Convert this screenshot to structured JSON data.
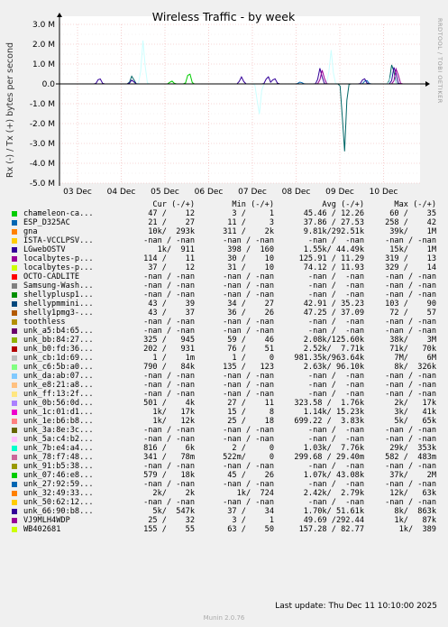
{
  "chart_data": {
    "type": "line",
    "title": "Wireless Traffic - by week",
    "ylabel": "Rx (-) / Tx (+) bytes per second",
    "ylim": [
      -5000000,
      3000000
    ],
    "y_ticks": [
      3000000,
      2000000,
      1000000,
      0,
      -1000000,
      -2000000,
      -3000000,
      -4000000,
      -5000000
    ],
    "y_tick_labels": [
      "3.0 M",
      "2.0 M",
      "1.0 M",
      "0.0",
      "-1.0 M",
      "-2.0 M",
      "-3.0 M",
      "-4.0 M",
      "-5.0 M"
    ],
    "x_tick_labels": [
      "03 Dec",
      "04 Dec",
      "05 Dec",
      "06 Dec",
      "07 Dec",
      "08 Dec",
      "09 Dec",
      "10 Dec"
    ],
    "grid": true,
    "series": [
      {
        "name": "chameleon-ca...",
        "color": "#00cc00",
        "peaks": [
          [
            2.55,
            600000
          ],
          [
            2.15,
            150000
          ]
        ]
      },
      {
        "name": "ESP_D325AC",
        "color": "#0066b3",
        "peaks": [
          [
            6.6,
            200000
          ],
          [
            5.1,
            100000
          ]
        ]
      },
      {
        "name": "shellypmmini...",
        "color": "#006666",
        "peaks": [
          [
            1.25,
            400000
          ],
          [
            6.1,
            1300000
          ],
          [
            6.1,
            -4800000
          ],
          [
            7.2,
            1050000
          ]
        ]
      },
      {
        "name": "unk_7b:e4:a4...",
        "color": "#ccffff",
        "peaks": [
          [
            1.5,
            2200000
          ],
          [
            4.15,
            2400000
          ],
          [
            4.15,
            -4000000
          ],
          [
            5.8,
            1700000
          ],
          [
            7.2,
            1400000
          ],
          [
            7.2,
            -800000
          ]
        ]
      },
      {
        "name": "unk_a5:b4:65...",
        "color": "#330099",
        "peaks": [
          [
            0.5,
            300000
          ],
          [
            3.75,
            350000
          ],
          [
            4.35,
            400000
          ],
          [
            5.55,
            800000
          ],
          [
            7.25,
            900000
          ],
          [
            4.5,
            300000
          ],
          [
            6.55,
            300000
          ],
          [
            1.25,
            200000
          ]
        ]
      },
      {
        "name": "unk_bb:84:27...",
        "color": "#990099",
        "peaks": [
          [
            5.6,
            700000
          ],
          [
            7.3,
            800000
          ]
        ]
      }
    ]
  },
  "side_text": "RRDTOOL / TOBI OETIKER",
  "legend": {
    "headers": {
      "cur": "Cur (-/+)",
      "min": "Min (-/+)",
      "avg": "Avg (-/+)",
      "max": "Max (-/+)"
    },
    "rows": [
      {
        "name": "chameleon-ca...",
        "color": "#00cc00",
        "cur": "47 /    12",
        "min": "3 /     1",
        "avg": "45.46 / 12.26",
        "max": "60 /    35"
      },
      {
        "name": "ESP_D325AC",
        "color": "#0066b3",
        "cur": "21 /    27",
        "min": "11 /     3",
        "avg": "37.86 / 27.53",
        "max": "258 /    42"
      },
      {
        "name": "gna",
        "color": "#ff8000",
        "cur": "10k/  293k",
        "min": "311 /    2k",
        "avg": "9.81k/292.51k",
        "max": "39k/    1M"
      },
      {
        "name": "ISTA-VCCLPSV...",
        "color": "#ffcc00",
        "cur": "-nan / -nan",
        "min": "-nan / -nan",
        "avg": "-nan /  -nan",
        "max": "-nan / -nan"
      },
      {
        "name": "LGwebOSTV",
        "color": "#330099",
        "cur": "1k/  911",
        "min": "398 /  160",
        "avg": "1.55k/ 44.49k",
        "max": "15k/    1M"
      },
      {
        "name": "localbytes-p...",
        "color": "#990099",
        "cur": "114 /    11",
        "min": "30 /    10",
        "avg": "125.91 / 11.29",
        "max": "319 /    13"
      },
      {
        "name": "localbytes-p...",
        "color": "#ccff00",
        "cur": "37 /    12",
        "min": "31 /    10",
        "avg": "74.12 / 11.93",
        "max": "329 /    14"
      },
      {
        "name": "OCTO-CADLITE",
        "color": "#ff0000",
        "cur": "-nan / -nan",
        "min": "-nan / -nan",
        "avg": "-nan /  -nan",
        "max": "-nan / -nan"
      },
      {
        "name": "Samsung-Wash...",
        "color": "#808080",
        "cur": "-nan / -nan",
        "min": "-nan / -nan",
        "avg": "-nan /  -nan",
        "max": "-nan / -nan"
      },
      {
        "name": "shellyplusp1...",
        "color": "#008f00",
        "cur": "-nan / -nan",
        "min": "-nan / -nan",
        "avg": "-nan /  -nan",
        "max": "-nan / -nan"
      },
      {
        "name": "shellypmmini...",
        "color": "#00487d",
        "cur": "43 /    39",
        "min": "34 /    27",
        "avg": "42.91 / 35.23",
        "max": "103 /    90"
      },
      {
        "name": "shelly1pmg3-...",
        "color": "#b35a00",
        "cur": "43 /    37",
        "min": "36 /    26",
        "avg": "47.25 / 37.09",
        "max": "72 /    57"
      },
      {
        "name": "toothless",
        "color": "#b38f00",
        "cur": "-nan / -nan",
        "min": "-nan / -nan",
        "avg": "-nan /  -nan",
        "max": "-nan / -nan"
      },
      {
        "name": "unk_a5:b4:65...",
        "color": "#6b006b",
        "cur": "-nan / -nan",
        "min": "-nan / -nan",
        "avg": "-nan /  -nan",
        "max": "-nan / -nan"
      },
      {
        "name": "unk_bb:84:27...",
        "color": "#8fb300",
        "cur": "325 /   945",
        "min": "59 /    46",
        "avg": "2.08k/125.60k",
        "max": "38k/    3M"
      },
      {
        "name": "unk_b0:fd:36...",
        "color": "#b30000",
        "cur": "202 /   931",
        "min": "76 /    51",
        "avg": "2.52k/  7.71k",
        "max": "71k/   70k"
      },
      {
        "name": "unk_cb:1d:69...",
        "color": "#bebebe",
        "cur": "1 /    1m",
        "min": "1 /     0",
        "avg": "981.35k/963.64k",
        "max": "7M/    6M"
      },
      {
        "name": "unk_c6:5b:a0...",
        "color": "#80ff80",
        "cur": "790 /   84k",
        "min": "135 /   123",
        "avg": "2.63k/ 96.10k",
        "max": "8k/  326k"
      },
      {
        "name": "unk_da:ab:07...",
        "color": "#80c9ff",
        "cur": "-nan / -nan",
        "min": "-nan / -nan",
        "avg": "-nan /  -nan",
        "max": "-nan / -nan"
      },
      {
        "name": "unk_e8:21:a8...",
        "color": "#ffc080",
        "cur": "-nan / -nan",
        "min": "-nan / -nan",
        "avg": "-nan /  -nan",
        "max": "-nan / -nan"
      },
      {
        "name": "unk_ff:13:2f...",
        "color": "#ffe680",
        "cur": "-nan / -nan",
        "min": "-nan / -nan",
        "avg": "-nan /  -nan",
        "max": "-nan / -nan"
      },
      {
        "name": "unk_0b:56:0d...",
        "color": "#aa80ff",
        "cur": "501 /    4k",
        "min": "27 /    11",
        "avg": "323.58 /  1.76k",
        "max": "2k/   17k"
      },
      {
        "name": "unk_1c:01:d1...",
        "color": "#ee00cc",
        "cur": "1k/   17k",
        "min": "15 /     8",
        "avg": "1.14k/ 15.23k",
        "max": "3k/   41k"
      },
      {
        "name": "unk_1e:b6:b8...",
        "color": "#ff8080",
        "cur": "1k/   12k",
        "min": "25 /    18",
        "avg": "699.22 /  3.83k",
        "max": "5k/   65k"
      },
      {
        "name": "unk_3a:8e:3c...",
        "color": "#666600",
        "cur": "-nan / -nan",
        "min": "-nan / -nan",
        "avg": "-nan /  -nan",
        "max": "-nan / -nan"
      },
      {
        "name": "unk_5a:c4:b2...",
        "color": "#ffbfff",
        "cur": "-nan / -nan",
        "min": "-nan / -nan",
        "avg": "-nan /  -nan",
        "max": "-nan / -nan"
      },
      {
        "name": "unk_7b:e4:a4...",
        "color": "#00ffcc",
        "cur": "816 /    6k",
        "min": "2 /     0",
        "avg": "1.03k/  7.76k",
        "max": "29k/  353k"
      },
      {
        "name": "unk_78:f7:48...",
        "color": "#cc6699",
        "cur": "341 /   78m",
        "min": "522m/     0",
        "avg": "299.68 / 29.40m",
        "max": "582 /  483m"
      },
      {
        "name": "unk_91:b5:38...",
        "color": "#999900",
        "cur": "-nan / -nan",
        "min": "-nan / -nan",
        "avg": "-nan /  -nan",
        "max": "-nan / -nan"
      },
      {
        "name": "unk_07:46:e8...",
        "color": "#00cc00",
        "cur": "579 /   18k",
        "min": "45 /    26",
        "avg": "1.07k/ 43.08k",
        "max": "37k/    2M"
      },
      {
        "name": "unk_27:92:59...",
        "color": "#0066b3",
        "cur": "-nan / -nan",
        "min": "-nan / -nan",
        "avg": "-nan /  -nan",
        "max": "-nan / -nan"
      },
      {
        "name": "unk_32:49:33...",
        "color": "#ff8000",
        "cur": "2k/    2k",
        "min": "1k/  724",
        "avg": "2.42k/  2.79k",
        "max": "12k/   63k"
      },
      {
        "name": "unk_50:62:12...",
        "color": "#ffcc00",
        "cur": "-nan / -nan",
        "min": "-nan / -nan",
        "avg": "-nan /  -nan",
        "max": "-nan / -nan"
      },
      {
        "name": "unk_66:90:b8...",
        "color": "#330099",
        "cur": "5k/  547k",
        "min": "37 /    34",
        "avg": "1.70k/ 51.61k",
        "max": "8k/  863k"
      },
      {
        "name": "VJ9MLH4WDP",
        "color": "#990099",
        "cur": "25 /    32",
        "min": "3 /     1",
        "avg": "49.69 /292.44",
        "max": "1k/   87k"
      },
      {
        "name": "WB402681",
        "color": "#ccff00",
        "cur": "155 /    55",
        "min": "63 /    50",
        "avg": "157.28 / 82.77",
        "max": "1k/  389"
      }
    ]
  },
  "footer": "Last update:  Thu Dec 11 10:10:00 2025",
  "munin": "Munin 2.0.76"
}
